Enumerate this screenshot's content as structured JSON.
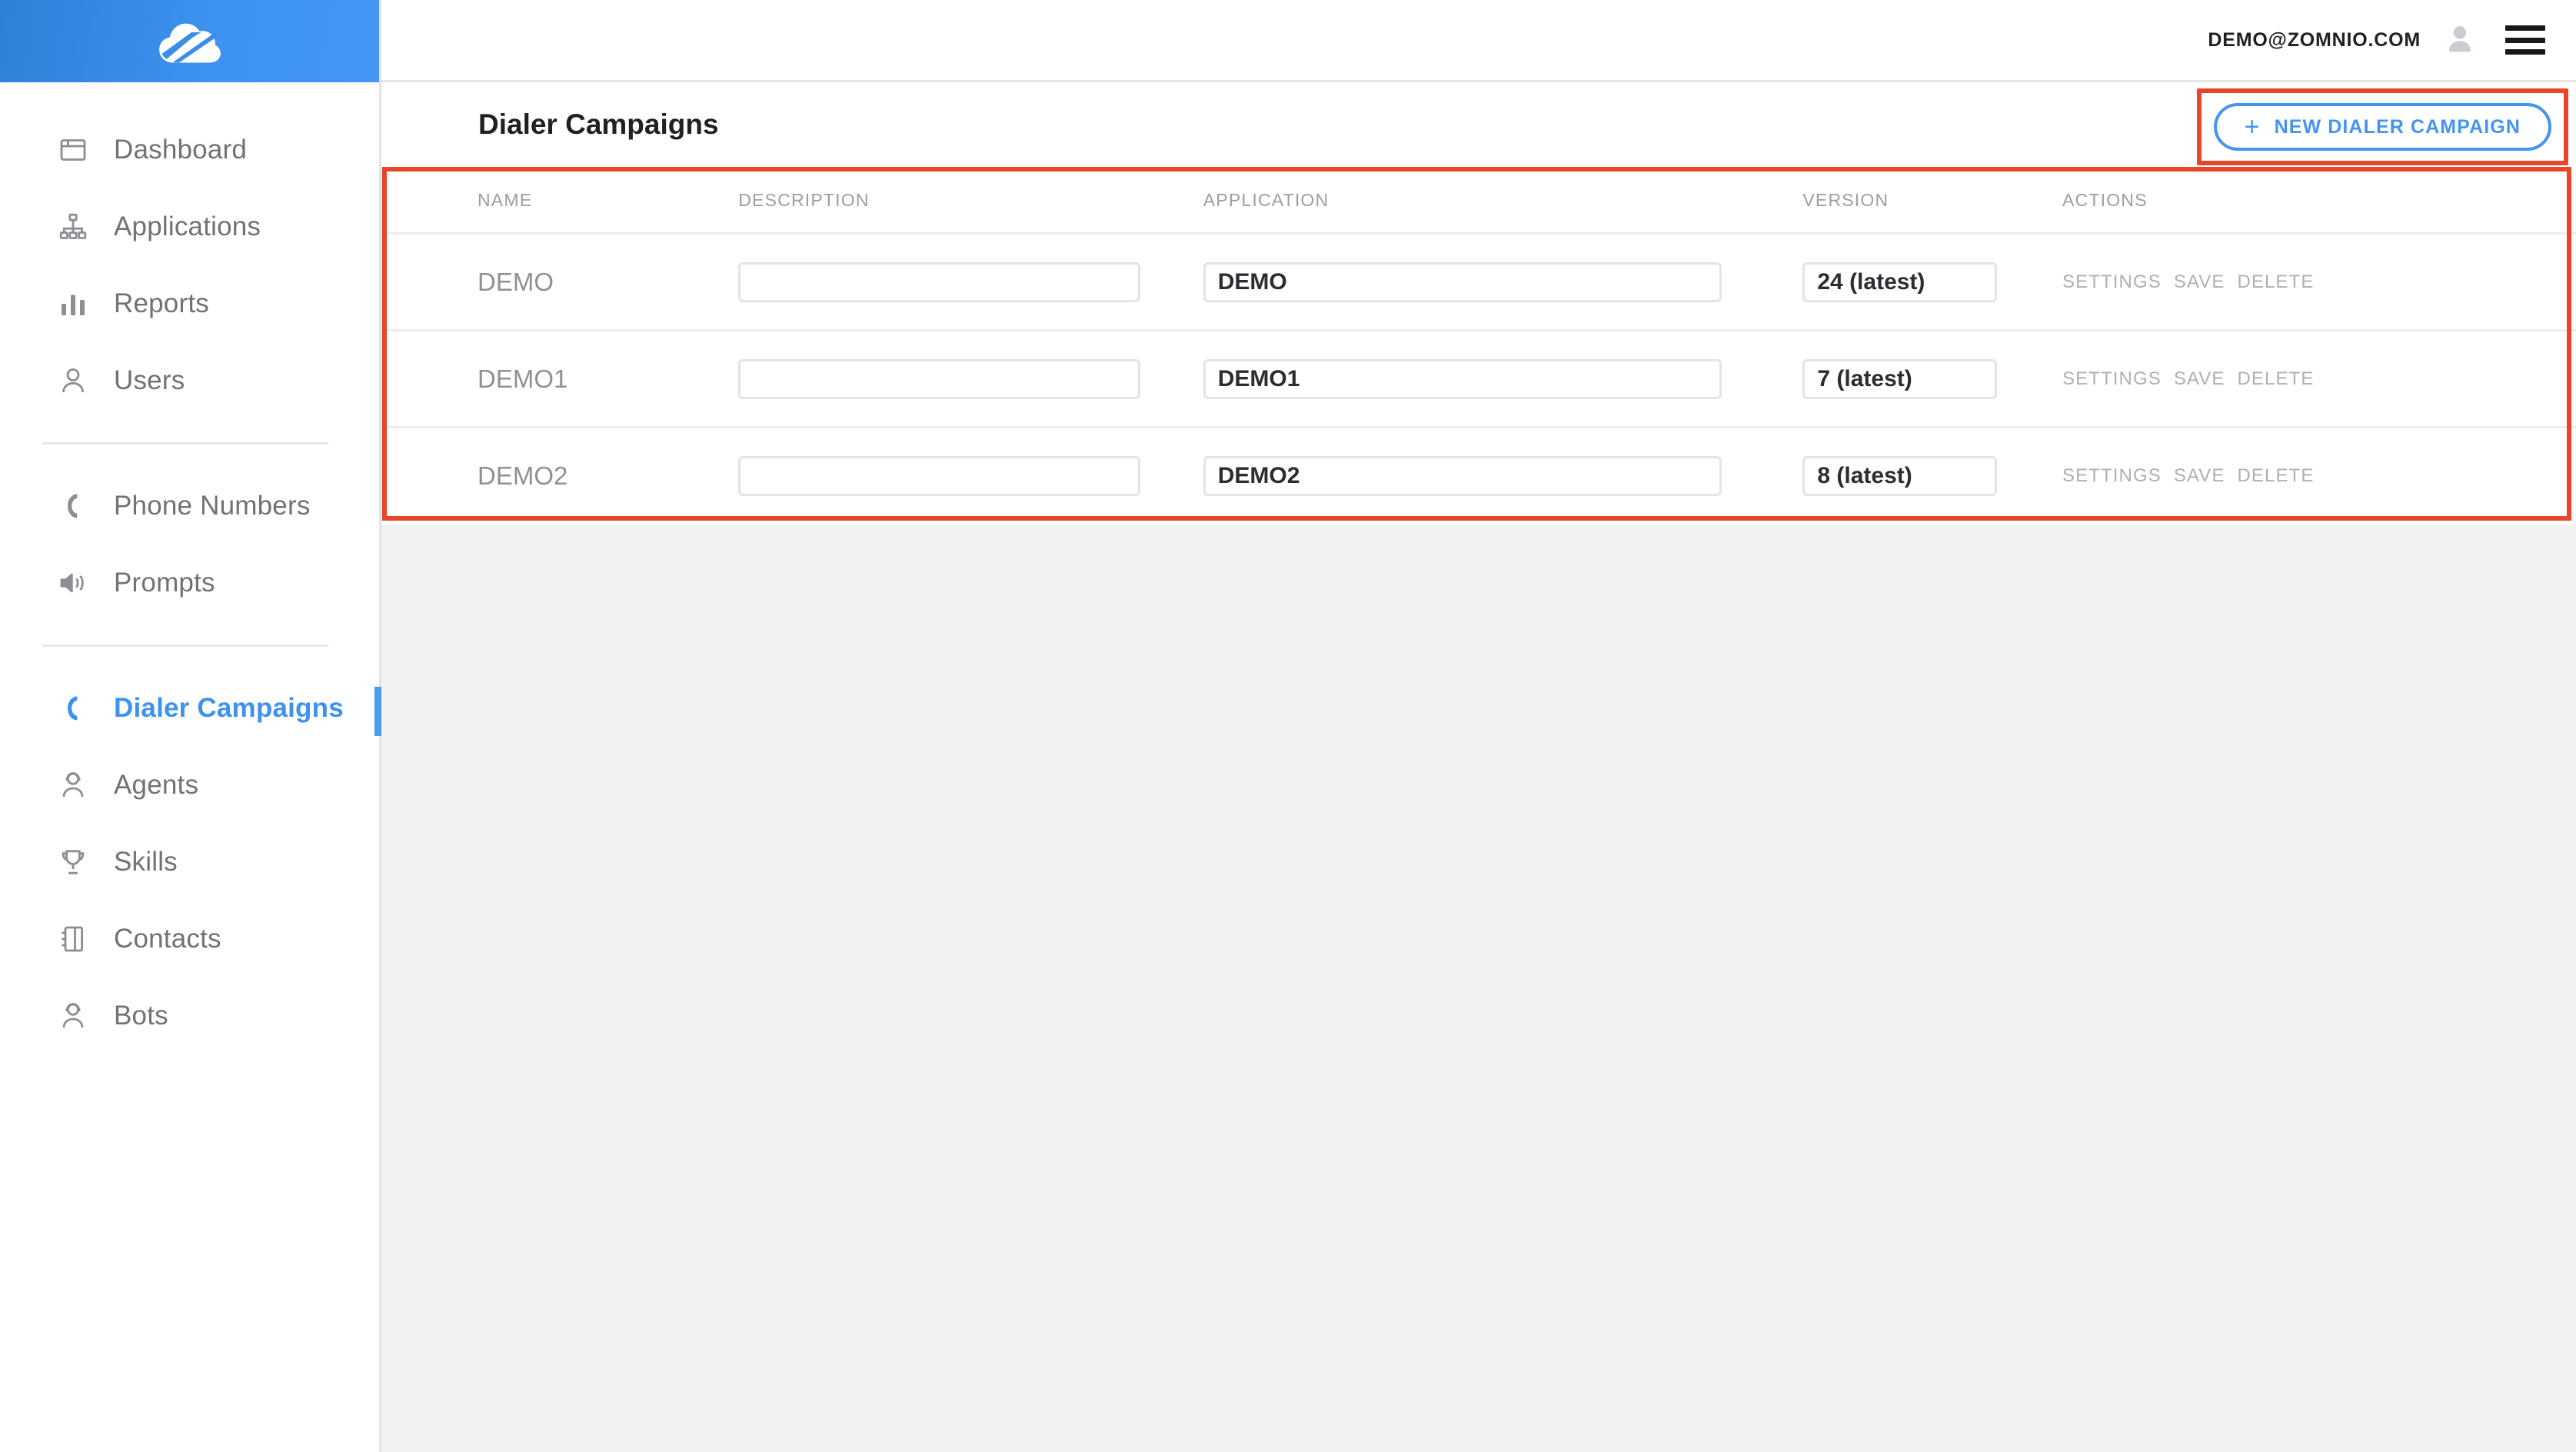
{
  "brand": {
    "logo_icon": "cloud-logo-icon",
    "accent_blue": "#3d92f0",
    "highlight_red": "#e8452a"
  },
  "topbar": {
    "user_email": "DEMO@ZOMNIO.COM",
    "avatar_icon": "user-avatar-icon",
    "menu_icon": "hamburger-menu-icon"
  },
  "sidebar": {
    "groups": [
      {
        "items": [
          {
            "label": "Dashboard",
            "icon": "window-icon",
            "active": false
          },
          {
            "label": "Applications",
            "icon": "sitemap-icon",
            "active": false
          },
          {
            "label": "Reports",
            "icon": "bar-chart-icon",
            "active": false
          },
          {
            "label": "Users",
            "icon": "user-icon",
            "active": false
          }
        ]
      },
      {
        "items": [
          {
            "label": "Phone Numbers",
            "icon": "phone-icon",
            "active": false
          },
          {
            "label": "Prompts",
            "icon": "speaker-icon",
            "active": false
          }
        ]
      },
      {
        "items": [
          {
            "label": "Dialer Campaigns",
            "icon": "phone-icon",
            "active": true
          },
          {
            "label": "Agents",
            "icon": "headset-user-icon",
            "active": false
          },
          {
            "label": "Skills",
            "icon": "trophy-icon",
            "active": false
          },
          {
            "label": "Contacts",
            "icon": "address-book-icon",
            "active": false
          },
          {
            "label": "Bots",
            "icon": "headset-user-icon",
            "active": false
          }
        ]
      }
    ]
  },
  "page": {
    "title": "Dialer Campaigns",
    "new_button": {
      "plus": "+",
      "label": "NEW DIALER CAMPAIGN"
    }
  },
  "table": {
    "columns": [
      "NAME",
      "DESCRIPTION",
      "APPLICATION",
      "VERSION",
      "ACTIONS"
    ],
    "actions": [
      "SETTINGS",
      "SAVE",
      "DELETE"
    ],
    "description_placeholder": "",
    "rows": [
      {
        "name": "DEMO",
        "description": "",
        "application": "DEMO",
        "version": "24 (latest)"
      },
      {
        "name": "DEMO1",
        "description": "",
        "application": "DEMO1",
        "version": "7 (latest)"
      },
      {
        "name": "DEMO2",
        "description": "",
        "application": "DEMO2",
        "version": "8 (latest)"
      }
    ]
  }
}
